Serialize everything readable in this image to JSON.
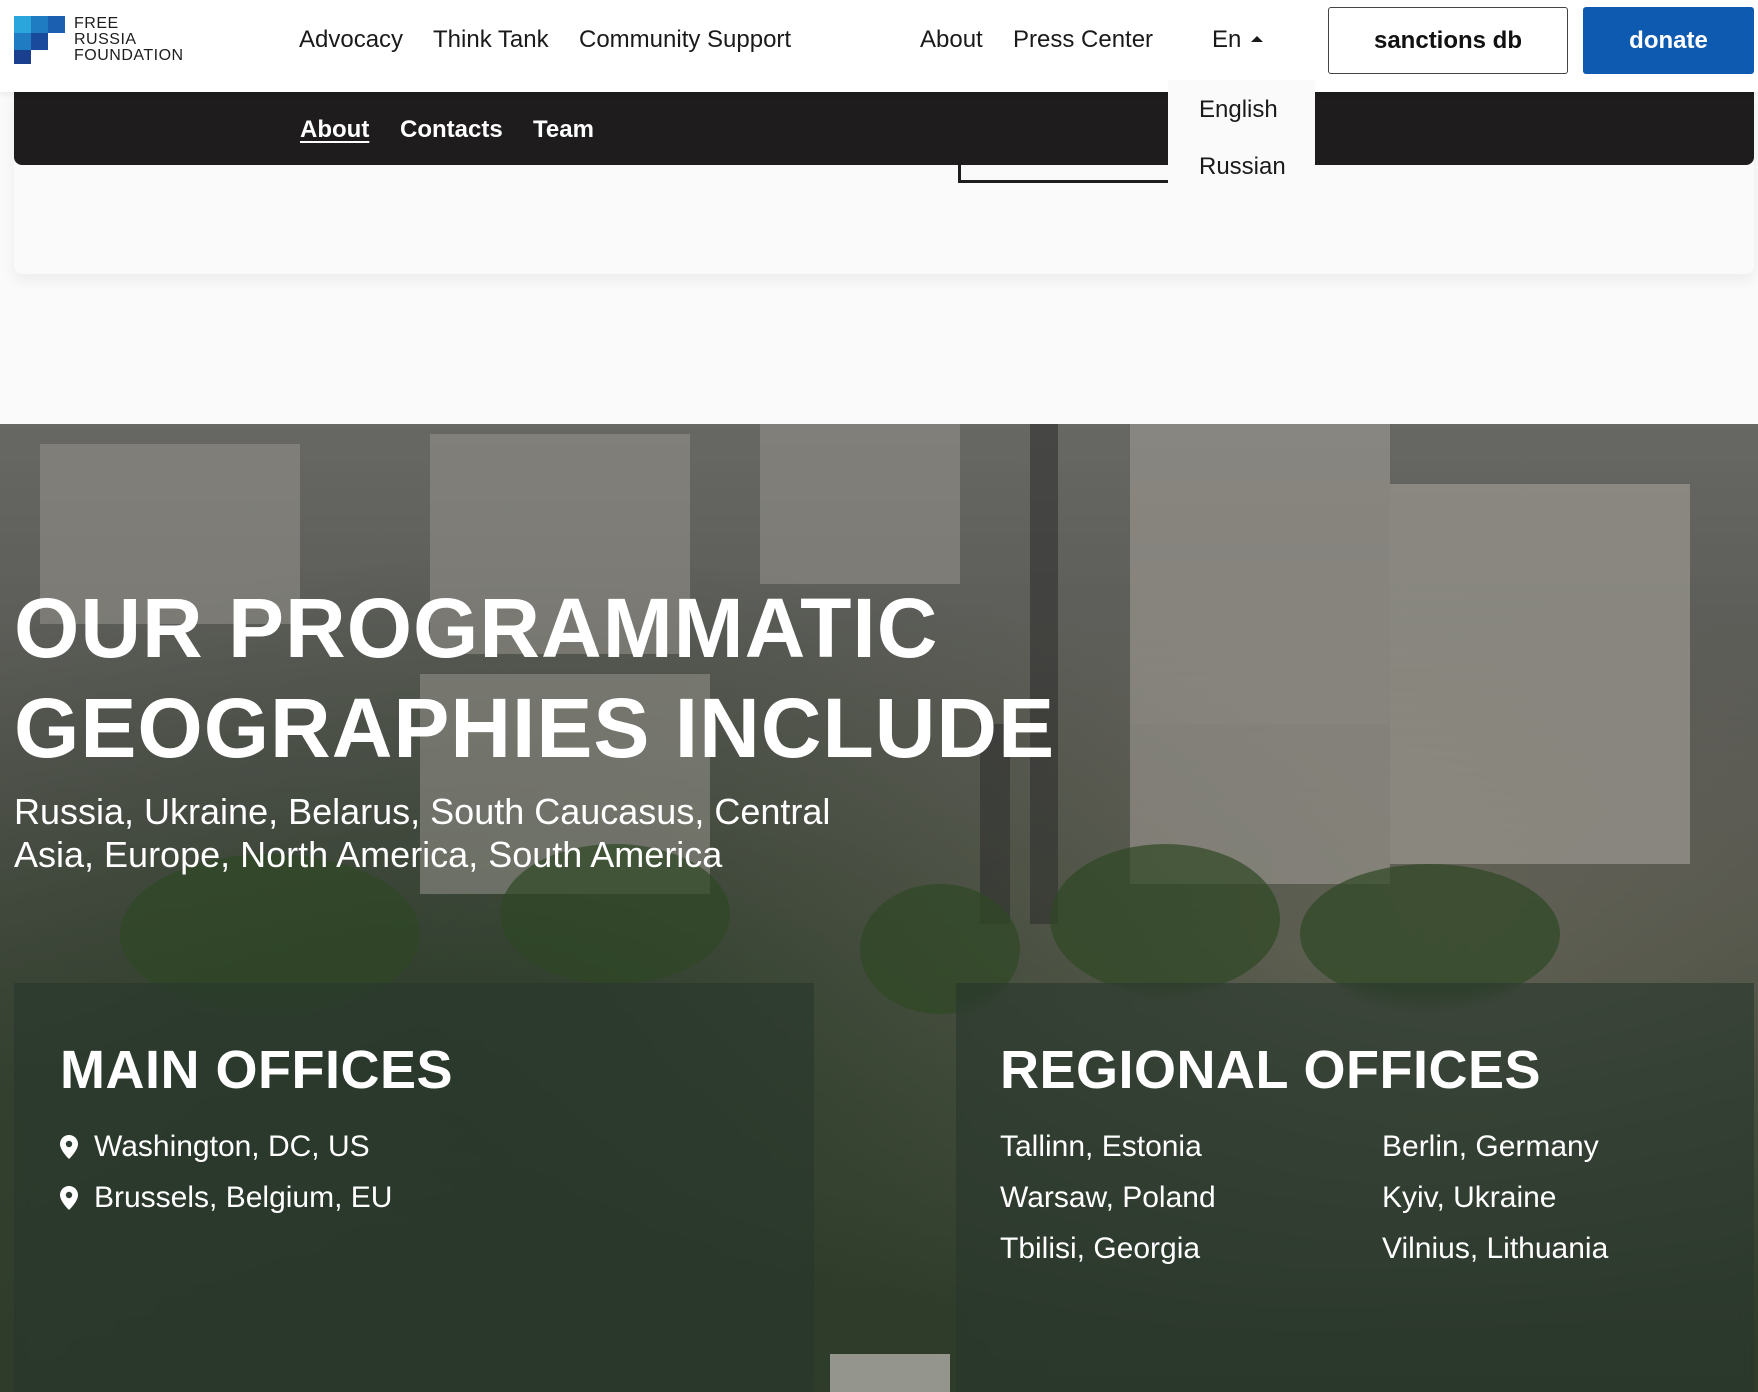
{
  "logo": {
    "line1": "FREE",
    "line2": "RUSSIA",
    "line3": "FOUNDATION"
  },
  "nav": {
    "advocacy": "Advocacy",
    "think_tank": "Think Tank",
    "community_support": "Community Support",
    "about": "About",
    "press_center": "Press Center",
    "language": "En",
    "sanctions": "sanctions db",
    "donate": "donate"
  },
  "language_menu": {
    "english": "English",
    "russian": "Russian"
  },
  "subnav": {
    "about": "About",
    "contacts": "Contacts",
    "team": "Team"
  },
  "hero": {
    "title_line1": "OUR PROGRAMMATIC",
    "title_line2": "GEOGRAPHIES INCLUDE",
    "subtitle": "Russia, Ukraine, Belarus, South Caucasus, Central Asia, Europe, North America, South America"
  },
  "main_offices": {
    "title": "MAIN OFFICES",
    "locations": [
      "Washington, DC, US",
      "Brussels, Belgium, EU"
    ]
  },
  "regional_offices": {
    "title": "REGIONAL OFFICES",
    "col1": [
      "Tallinn, Estonia",
      "Warsaw, Poland",
      "Tbilisi, Georgia"
    ],
    "col2": [
      "Berlin, Germany",
      "Kyiv, Ukraine",
      "Vilnius, Lithuania"
    ]
  },
  "colors": {
    "brand_blue": "#0e5ab1",
    "dark_bar": "#1e1c1d",
    "logo_light": "#2aa6dc",
    "logo_dark": "#1b3f8f"
  }
}
